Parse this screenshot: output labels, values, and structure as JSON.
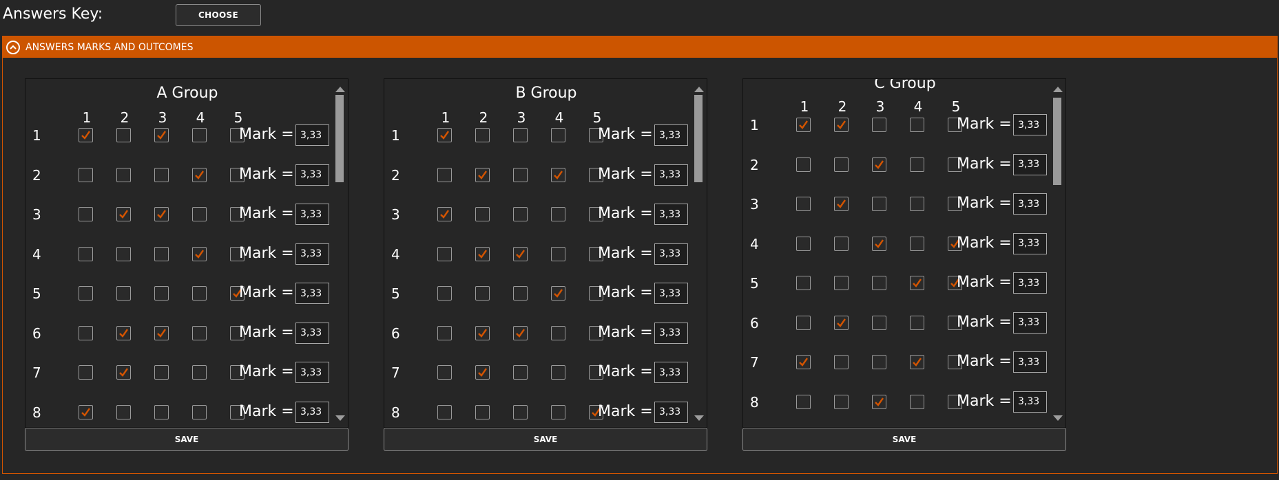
{
  "top": {
    "label": "Answers Key:",
    "choose_button": "CHOOSE"
  },
  "expander": {
    "title": "ANSWERS MARKS AND OUTCOMES"
  },
  "colors": {
    "accent": "#cc5500",
    "background": "#262626",
    "check": "#d35400"
  },
  "groups": [
    {
      "title": "A Group",
      "columns": [
        "1",
        "2",
        "3",
        "4",
        "5"
      ],
      "mark_label": "Mark =",
      "save_label": "SAVE",
      "scroll": "top",
      "rows": [
        {
          "num": "1",
          "checks": [
            true,
            false,
            true,
            false,
            false
          ],
          "mark": "3,33"
        },
        {
          "num": "2",
          "checks": [
            false,
            false,
            false,
            true,
            false
          ],
          "mark": "3,33"
        },
        {
          "num": "3",
          "checks": [
            false,
            true,
            true,
            false,
            false
          ],
          "mark": "3,33"
        },
        {
          "num": "4",
          "checks": [
            false,
            false,
            false,
            true,
            false
          ],
          "mark": "3,33"
        },
        {
          "num": "5",
          "checks": [
            false,
            false,
            false,
            false,
            true
          ],
          "mark": "3,33"
        },
        {
          "num": "6",
          "checks": [
            false,
            true,
            true,
            false,
            false
          ],
          "mark": "3,33"
        },
        {
          "num": "7",
          "checks": [
            false,
            true,
            false,
            false,
            false
          ],
          "mark": "3,33"
        },
        {
          "num": "8",
          "checks": [
            true,
            false,
            false,
            false,
            false
          ],
          "mark": "3,33"
        }
      ]
    },
    {
      "title": "B Group",
      "columns": [
        "1",
        "2",
        "3",
        "4",
        "5"
      ],
      "mark_label": "Mark =",
      "save_label": "SAVE",
      "scroll": "top",
      "rows": [
        {
          "num": "1",
          "checks": [
            true,
            false,
            false,
            false,
            false
          ],
          "mark": "3,33"
        },
        {
          "num": "2",
          "checks": [
            false,
            true,
            false,
            true,
            false
          ],
          "mark": "3,33"
        },
        {
          "num": "3",
          "checks": [
            true,
            false,
            false,
            false,
            false
          ],
          "mark": "3,33"
        },
        {
          "num": "4",
          "checks": [
            false,
            true,
            true,
            false,
            false
          ],
          "mark": "3,33"
        },
        {
          "num": "5",
          "checks": [
            false,
            false,
            false,
            true,
            false
          ],
          "mark": "3,33"
        },
        {
          "num": "6",
          "checks": [
            false,
            true,
            true,
            false,
            false
          ],
          "mark": "3,33"
        },
        {
          "num": "7",
          "checks": [
            false,
            true,
            false,
            false,
            false
          ],
          "mark": "3,33"
        },
        {
          "num": "8",
          "checks": [
            false,
            false,
            false,
            false,
            true
          ],
          "mark": "3,33"
        }
      ]
    },
    {
      "title": "C Group",
      "columns": [
        "1",
        "2",
        "3",
        "4",
        "5"
      ],
      "mark_label": "Mark =",
      "save_label": "SAVE",
      "scroll": "scrolled",
      "rows": [
        {
          "num": "1",
          "checks": [
            true,
            true,
            false,
            false,
            false
          ],
          "mark": "3,33"
        },
        {
          "num": "2",
          "checks": [
            false,
            false,
            true,
            false,
            false
          ],
          "mark": "3,33"
        },
        {
          "num": "3",
          "checks": [
            false,
            true,
            false,
            false,
            false
          ],
          "mark": "3,33"
        },
        {
          "num": "4",
          "checks": [
            false,
            false,
            true,
            false,
            true
          ],
          "mark": "3,33"
        },
        {
          "num": "5",
          "checks": [
            false,
            false,
            false,
            true,
            true
          ],
          "mark": "3,33"
        },
        {
          "num": "6",
          "checks": [
            false,
            true,
            false,
            false,
            false
          ],
          "mark": "3,33"
        },
        {
          "num": "7",
          "checks": [
            true,
            false,
            false,
            true,
            false
          ],
          "mark": "3,33"
        },
        {
          "num": "8",
          "checks": [
            false,
            false,
            true,
            false,
            false
          ],
          "mark": "3,33"
        }
      ]
    }
  ]
}
